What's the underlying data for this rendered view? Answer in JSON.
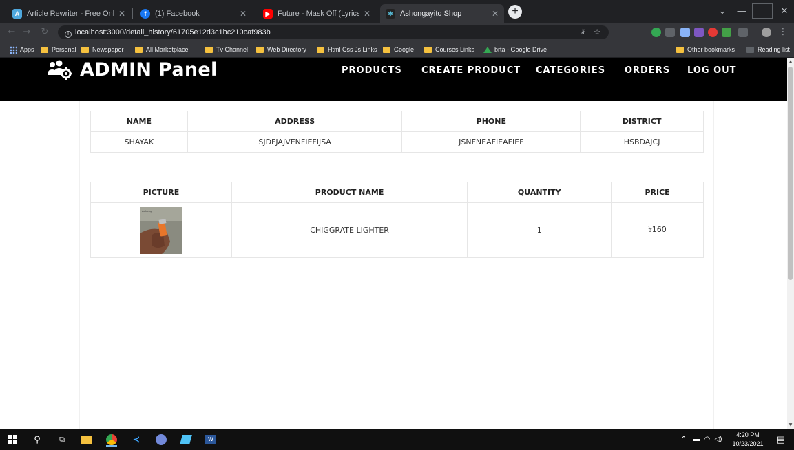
{
  "browser": {
    "tabs": [
      {
        "title": "Article Rewriter - Free Online Arti",
        "favicon": "article-rewriter-icon",
        "color": "#4ea8de"
      },
      {
        "title": "(1) Facebook",
        "favicon": "facebook-icon",
        "color": "#1877f2"
      },
      {
        "title": "Future - Mask Off (Lyrics / Lyric V",
        "favicon": "youtube-icon",
        "color": "#ff0000"
      },
      {
        "title": "Ashongayito Shop",
        "favicon": "react-icon",
        "color": "#61dafb",
        "active": true
      }
    ],
    "url": "localhost:3000/detail_history/61705e12d3c1bc210caf983b",
    "bookmarks": [
      {
        "label": "Apps",
        "icon": "apps-icon"
      },
      {
        "label": "Personal",
        "icon": "folder-icon"
      },
      {
        "label": "Newspaper",
        "icon": "folder-icon"
      },
      {
        "label": "All Marketplace",
        "icon": "folder-icon"
      },
      {
        "label": "Tv Channel",
        "icon": "folder-icon"
      },
      {
        "label": "Web Directory",
        "icon": "folder-icon"
      },
      {
        "label": "Html Css Js Links",
        "icon": "folder-icon"
      },
      {
        "label": "Google",
        "icon": "folder-icon"
      },
      {
        "label": "Courses Links",
        "icon": "folder-icon"
      },
      {
        "label": "brta - Google Drive",
        "icon": "drive-icon"
      }
    ],
    "other_bookmarks": "Other bookmarks",
    "reading_list": "Reading list"
  },
  "admin": {
    "brand": "ADMIN Panel",
    "nav": [
      "PRODUCTS",
      "CREATE PRODUCT",
      "CATEGORIES",
      "ORDERS",
      "LOG OUT"
    ]
  },
  "customer_table": {
    "headers": [
      "NAME",
      "ADDRESS",
      "PHONE",
      "DISTRICT"
    ],
    "row": [
      "SHAYAK",
      "SJDFJAJVENFIEFIJSA",
      "JSNFNEAFIEAFIEF",
      "HSBDAJCJ"
    ]
  },
  "product_table": {
    "headers": [
      "PICTURE",
      "PRODUCT NAME",
      "QUANTITY",
      "PRICE"
    ],
    "row": {
      "picture": "lighter-product-image",
      "name": "CHIGGRATE LIGHTER",
      "quantity": "1",
      "price": "৳160"
    }
  },
  "taskbar": {
    "time": "4:20 PM",
    "date": "10/23/2021"
  }
}
